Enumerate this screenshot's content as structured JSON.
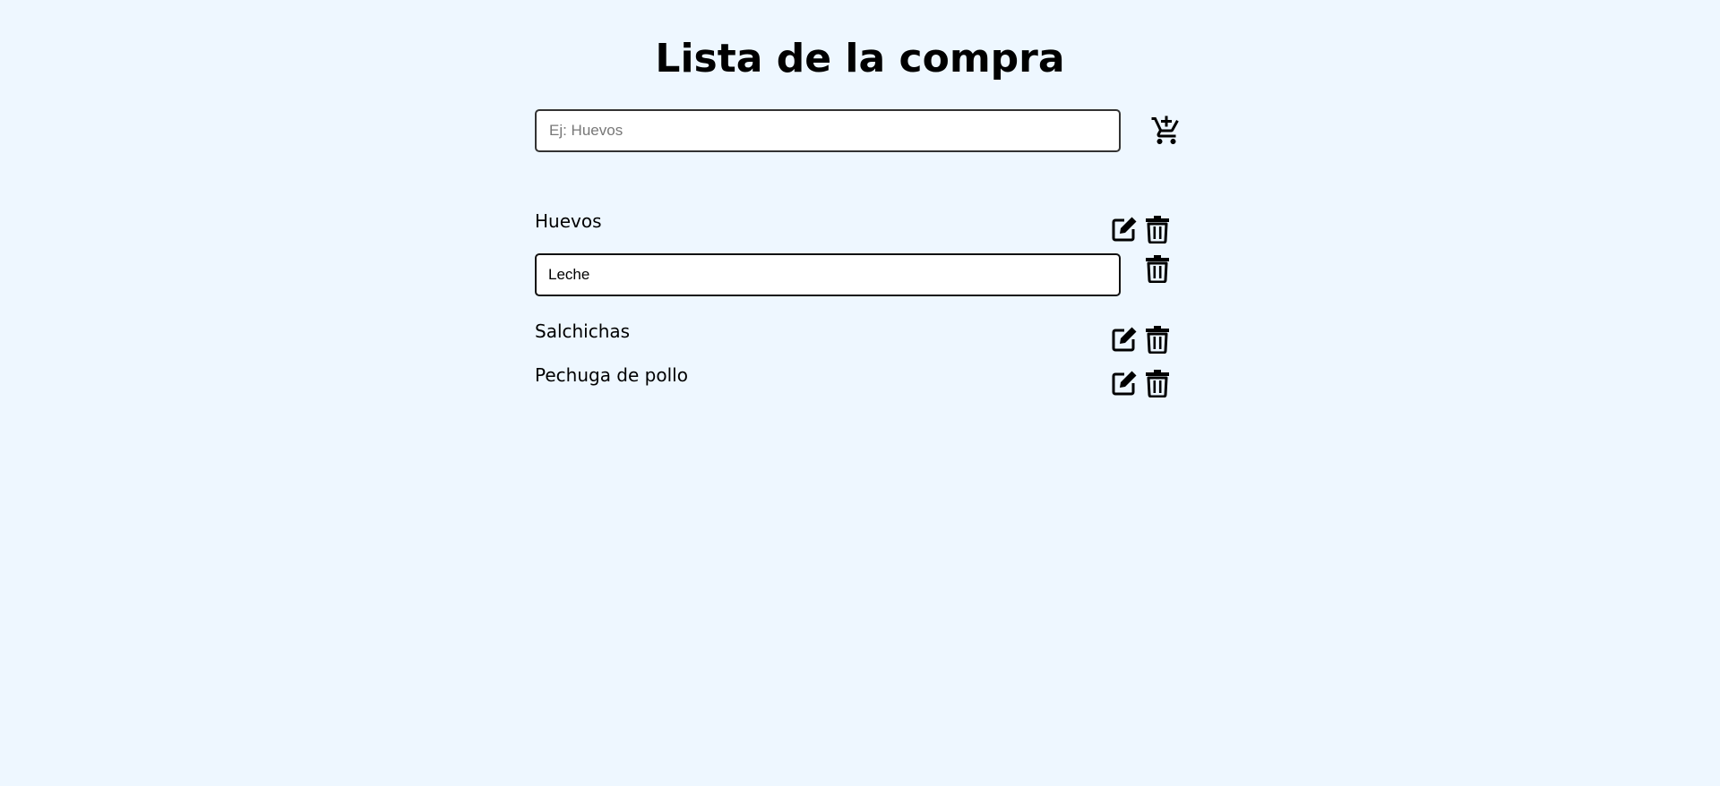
{
  "header": {
    "title": "Lista de la compra"
  },
  "new_item": {
    "placeholder": "Ej: Huevos",
    "value": "",
    "add_icon": "add-to-cart-icon"
  },
  "items": [
    {
      "label": "Huevos",
      "editing": false
    },
    {
      "label": "Leche",
      "editing": true
    },
    {
      "label": "Salchichas",
      "editing": false
    },
    {
      "label": "Pechuga de pollo",
      "editing": false
    }
  ],
  "icons": {
    "edit": "edit-icon",
    "delete": "trash-icon"
  },
  "colors": {
    "background": "#eef7ff",
    "text": "#000000",
    "input_border": "#333333"
  }
}
